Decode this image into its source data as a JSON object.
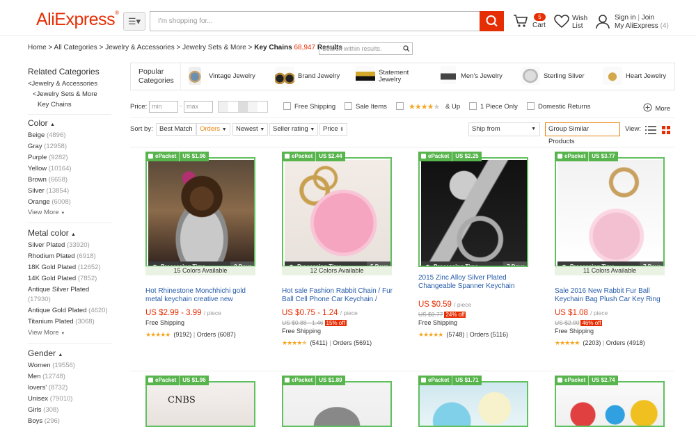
{
  "header": {
    "logo": "AliExpress",
    "search_placeholder": "I'm shopping for...",
    "cart_count": "5",
    "cart_label": "Cart",
    "wish_line1": "Wish",
    "wish_line2": "List",
    "sign_in": "Sign in",
    "join": "Join",
    "my_ali": "My AliExpress",
    "my_ali_count": "(4)"
  },
  "breadcrumb": {
    "home": "Home",
    "all": "All Categories",
    "jewelry": "Jewelry & Accessories",
    "sets": "Jewelry Sets & More",
    "current": "Key Chains",
    "count": "68,947",
    "results": "Results",
    "search_placeholder": "Search within results."
  },
  "sidebar": {
    "related_title": "Related Categories",
    "related": [
      "<Jewelry & Accessories",
      "<Jewelry Sets & More",
      "Key Chains"
    ],
    "color_title": "Color",
    "colors": [
      {
        "name": "Beige",
        "count": "(4896)"
      },
      {
        "name": "Gray",
        "count": "(12958)"
      },
      {
        "name": "Purple",
        "count": "(9282)"
      },
      {
        "name": "Yellow",
        "count": "(10164)"
      },
      {
        "name": "Brown",
        "count": "(6658)"
      },
      {
        "name": "Silver",
        "count": "(13854)"
      },
      {
        "name": "Orange",
        "count": "(6008)"
      }
    ],
    "view_more": "View More",
    "metal_title": "Metal color",
    "metals": [
      {
        "name": "Silver Plated",
        "count": "(33920)"
      },
      {
        "name": "Rhodium Plated",
        "count": "(6918)"
      },
      {
        "name": "18K Gold Plated",
        "count": "(12652)"
      },
      {
        "name": "14K Gold Plated",
        "count": "(7852)"
      },
      {
        "name": "Antique Silver Plated",
        "count": "(17930)"
      },
      {
        "name": "Antique Gold Plated",
        "count": "(4620)"
      },
      {
        "name": "Titanium Plated",
        "count": "(3068)"
      }
    ],
    "gender_title": "Gender",
    "genders": [
      {
        "name": "Women",
        "count": "(19556)"
      },
      {
        "name": "Men",
        "count": "(12748)"
      },
      {
        "name": "lovers'",
        "count": "(8732)"
      },
      {
        "name": "Unisex",
        "count": "(79010)"
      },
      {
        "name": "Girls",
        "count": "(308)"
      },
      {
        "name": "Boys",
        "count": "(296)"
      }
    ]
  },
  "popular": {
    "label_line1": "Popular",
    "label_line2": "Categories",
    "items": [
      {
        "label": "Vintage Jewelry"
      },
      {
        "label": "Brand Jewelry"
      },
      {
        "label_line1": "Statement",
        "label_line2": "Jewelry"
      },
      {
        "label": "Men's Jewelry"
      },
      {
        "label": "Sterling Silver"
      },
      {
        "label": "Heart Jewelry"
      }
    ]
  },
  "filters": {
    "price_label": "Price:",
    "min": "min",
    "max": "max",
    "free_shipping": "Free Shipping",
    "sale_items": "Sale Items",
    "and_up": "& Up",
    "one_piece": "1 Piece Only",
    "domestic": "Domestic Returns",
    "more": "More"
  },
  "sort": {
    "label": "Sort by:",
    "best_match": "Best Match",
    "orders": "Orders",
    "newest": "Newest",
    "seller_rating": "Seller rating",
    "price": "Price",
    "ship_from": "Ship from",
    "group": "Group Similar Products",
    "view": "View:"
  },
  "products": [
    {
      "epacket": "ePacket",
      "ship_price": "US $1.96",
      "processing": "Processing Time",
      "days": "3 Days",
      "colors": "15 Colors Available",
      "title": "Hot Rhinestone Monchhichi gold metal keychain creative new",
      "price": "US $2.99 - 3.99",
      "unit": "/ piece",
      "old": "",
      "off": "",
      "ship": "Free Shipping",
      "rating_count": "(9192)",
      "orders": "Orders (6087)"
    },
    {
      "epacket": "ePacket",
      "ship_price": "US $2.44",
      "processing": "Processing Time",
      "days": "5 Days",
      "colors": "12 Colors Available",
      "title": "Hot sale Fashion Rabbit Chain / Fur Ball Cell Phone Car Keychain /",
      "price": "US $0.75 - 1.24",
      "unit": "/ piece",
      "old": "US $0.88 - 1.46",
      "off": "15% off",
      "ship": "Free Shipping",
      "rating_count": "(5411)",
      "orders": "Orders (5691)"
    },
    {
      "epacket": "ePacket",
      "ship_price": "US $2.25",
      "processing": "Processing Time",
      "days": "7 Days",
      "colors": "",
      "title": "2015 Zinc Alloy Silver Plated Changeable Spanner Keychain",
      "price": "US $0.59",
      "unit": "/ piece",
      "old": "US $0.77",
      "off": "24% off",
      "ship": "Free Shipping",
      "rating_count": "(5748)",
      "orders": "Orders (5116)"
    },
    {
      "epacket": "ePacket",
      "ship_price": "US $3.77",
      "processing": "Processing Time",
      "days": "7 Days",
      "colors": "11 Colors Available",
      "title": "Sale 2016 New Rabbit Fur Ball Keychain Bag Plush Car Key Ring",
      "price": "US $1.08",
      "unit": "/ piece",
      "old": "US $2.00",
      "off": "46% off",
      "ship": "Free Shipping",
      "rating_count": "(2203)",
      "orders": "Orders (4918)"
    }
  ],
  "row2": [
    {
      "epacket": "ePacket",
      "ship_price": "US $1.96",
      "caption": "CNBS"
    },
    {
      "epacket": "ePacket",
      "ship_price": "US $1.89"
    },
    {
      "epacket": "ePacket",
      "ship_price": "US $1.71"
    },
    {
      "epacket": "ePacket",
      "ship_price": "US $2.74"
    }
  ],
  "colors": {
    "brand": "#e62e04",
    "epacket": "#58b44d",
    "link": "#245aa8"
  },
  "icons": [
    "menu-icon",
    "search-icon",
    "cart-icon",
    "heart-icon",
    "user-icon",
    "plus-circle-icon",
    "list-view-icon",
    "grid-view-icon",
    "clock-icon"
  ]
}
